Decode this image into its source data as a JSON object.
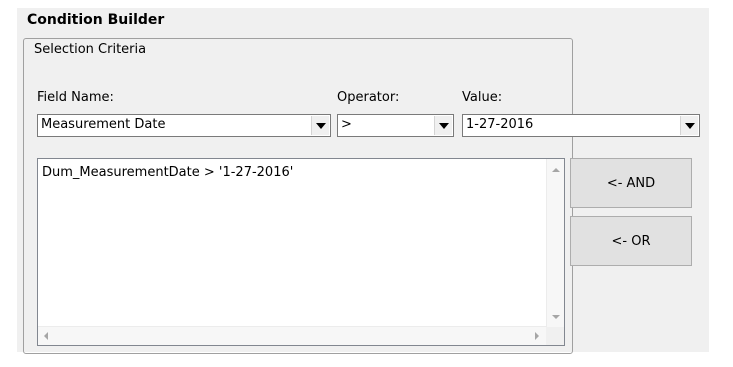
{
  "window": {
    "title": "Condition Builder"
  },
  "selection_criteria": {
    "legend": "Selection Criteria",
    "field_name": {
      "label": "Field Name:",
      "value": "Measurement Date"
    },
    "operator": {
      "label": "Operator:",
      "value": ">"
    },
    "value": {
      "label": "Value:",
      "value": "1-27-2016"
    },
    "condition_text": "Dum_MeasurementDate > '1-27-2016'"
  },
  "buttons": {
    "and_label": "<- AND",
    "or_label": "<- OR"
  },
  "icons": {
    "dropdown": "chevron-down-icon",
    "scroll_up": "scroll-up-arrow-icon",
    "scroll_down": "scroll-down-arrow-icon",
    "scroll_left": "scroll-left-arrow-icon",
    "scroll_right": "scroll-right-arrow-icon"
  },
  "colors": {
    "panel_background": "#f0f0f0",
    "button_face": "#e1e1e1"
  }
}
